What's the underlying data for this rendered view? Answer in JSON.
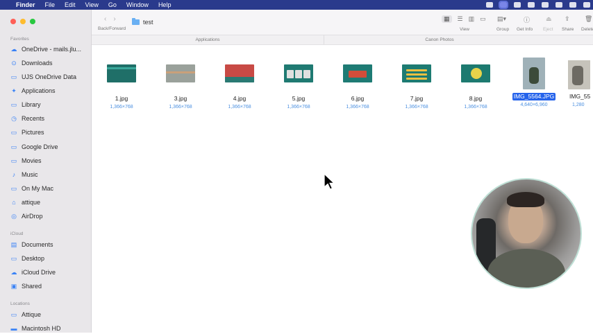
{
  "menubar": {
    "apple_glyph": "",
    "items": [
      "Finder",
      "File",
      "Edit",
      "View",
      "Go",
      "Window",
      "Help"
    ]
  },
  "toolbar": {
    "back_glyph": "‹",
    "forward_glyph": "›",
    "nav_label": "Back/Forward",
    "title": "test",
    "view_label": "View",
    "group_label": "Group",
    "getinfo_label": "Get Info",
    "eject_label": "Eject",
    "share_label": "Share",
    "delete_label": "Delete"
  },
  "tabs": [
    "Applications",
    "Canon Photos"
  ],
  "sidebar": {
    "favorites_header": "Favorites",
    "favorites": [
      {
        "label": "OneDrive - mails.jlu...",
        "icon": "cloud-icon"
      },
      {
        "label": "Downloads",
        "icon": "download-icon"
      },
      {
        "label": "UJS OneDrive Data",
        "icon": "folder-icon"
      },
      {
        "label": "Applications",
        "icon": "applications-icon"
      },
      {
        "label": "Library",
        "icon": "folder-icon"
      },
      {
        "label": "Recents",
        "icon": "clock-icon"
      },
      {
        "label": "Pictures",
        "icon": "folder-icon"
      },
      {
        "label": "Google Drive",
        "icon": "folder-icon"
      },
      {
        "label": "Movies",
        "icon": "folder-icon"
      },
      {
        "label": "Music",
        "icon": "music-icon"
      },
      {
        "label": "On My Mac",
        "icon": "folder-icon"
      },
      {
        "label": "attique",
        "icon": "home-icon"
      },
      {
        "label": "AirDrop",
        "icon": "airdrop-icon"
      }
    ],
    "icloud_header": "iCloud",
    "icloud": [
      {
        "label": "Documents",
        "icon": "document-icon"
      },
      {
        "label": "Desktop",
        "icon": "desktop-icon"
      },
      {
        "label": "iCloud Drive",
        "icon": "cloud-icon"
      },
      {
        "label": "Shared",
        "icon": "shared-folder-icon"
      }
    ],
    "locations_header": "Locations",
    "locations": [
      {
        "label": "Attique",
        "icon": "computer-icon"
      },
      {
        "label": "Macintosh HD",
        "icon": "drive-icon"
      }
    ]
  },
  "files": [
    {
      "name": "1.jpg",
      "dims": "1,366×768",
      "thumb": "#1f6f68",
      "accent": "#3aa89b"
    },
    {
      "name": "3.jpg",
      "dims": "1,366×768",
      "thumb": "#9aa19b",
      "accent": "#c9a07a"
    },
    {
      "name": "4.jpg",
      "dims": "1,366×768",
      "thumb": "#c84a45",
      "accent": "#2a7a73"
    },
    {
      "name": "5.jpg",
      "dims": "1,366×768",
      "thumb": "#1f7a72",
      "accent": "#e0e0e0"
    },
    {
      "name": "6.jpg",
      "dims": "1,366×768",
      "thumb": "#1e7b74",
      "accent": "#d24d3a"
    },
    {
      "name": "7.jpg",
      "dims": "1,366×768",
      "thumb": "#1d7b72",
      "accent": "#f0c040"
    },
    {
      "name": "8.jpg",
      "dims": "1,366×768",
      "thumb": "#1d7a70",
      "accent": "#e6d34a"
    },
    {
      "name": "IMG_5564.JPG",
      "dims": "4,640×6,960",
      "thumb": "#9fb1b8",
      "accent": "#3c4b3a",
      "selected": true
    },
    {
      "name": "IMG_55",
      "dims": "1,280",
      "thumb": "#c6c3bb",
      "accent": "#6d6a63"
    }
  ]
}
